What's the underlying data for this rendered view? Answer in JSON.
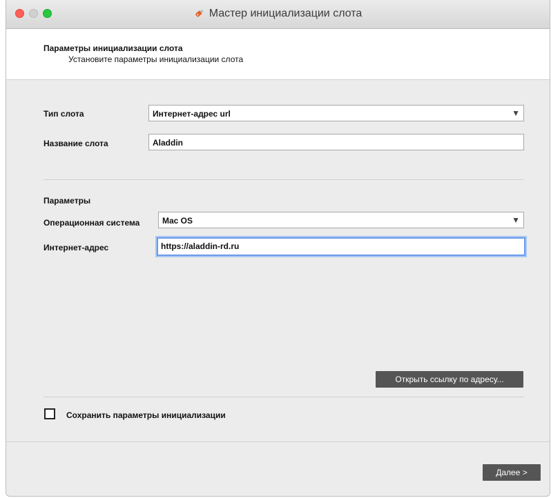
{
  "window": {
    "title": "Мастер инициализации слота"
  },
  "header": {
    "title": "Параметры инициализации слота",
    "subtitle": "Установите параметры инициализации слота"
  },
  "slot": {
    "type_label": "Тип слота",
    "type_value": "Интернет-адрес url",
    "name_label": "Название слота",
    "name_value": "Aladdin"
  },
  "params": {
    "section_label": "Параметры",
    "os_label": "Операционная система",
    "os_value": "Mac OS",
    "url_label": "Интернет-адрес",
    "url_value": "https://aladdin-rd.ru"
  },
  "buttons": {
    "open_link": "Открыть ссылку по адресу...",
    "next": "Далее >"
  },
  "save_checkbox": {
    "label": "Сохранить параметры инициализации",
    "checked": false
  },
  "colors": {
    "close": "#fe5f57",
    "minimize_disabled": "#d0d0d0",
    "maximize": "#28c840",
    "button_bg": "#555555",
    "focus_ring": "#6b9be8"
  }
}
